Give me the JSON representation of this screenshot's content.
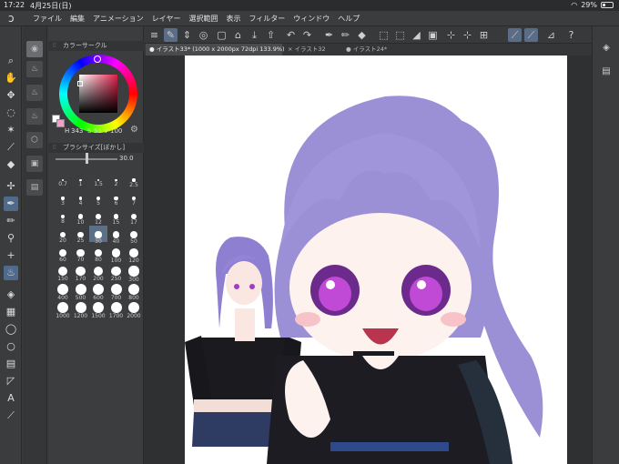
{
  "status": {
    "time": "17:22",
    "date": "4月25日(日)",
    "battery": "29%"
  },
  "menu": {
    "items": [
      "ファイル",
      "編集",
      "アニメーション",
      "レイヤー",
      "選択範囲",
      "表示",
      "フィルター",
      "ウィンドウ",
      "ヘルプ"
    ]
  },
  "color_panel": {
    "title": "カラーサークル",
    "h": "343",
    "s": "51",
    "v": "100",
    "h_mark": "H",
    "s_mark": "S",
    "v_mark": "V"
  },
  "brush_panel": {
    "title": "ブラシサイズ[ぼかし]",
    "value": "30.0",
    "sizes": [
      "0.7",
      "1",
      "1.5",
      "2",
      "2.5",
      "3",
      "4",
      "5",
      "6",
      "7",
      "8",
      "10",
      "12",
      "15",
      "17",
      "20",
      "25",
      "30",
      "40",
      "50",
      "60",
      "70",
      "80",
      "100",
      "120",
      "150",
      "170",
      "200",
      "250",
      "300",
      "400",
      "500",
      "600",
      "700",
      "800",
      "1000",
      "1200",
      "1500",
      "1700",
      "2000"
    ],
    "selected": "30"
  },
  "tabs": [
    {
      "label": "● イラスト33* (1000 x 2000px 72dpi 133.9%)",
      "active": true
    },
    {
      "label": "× イラスト32",
      "active": false
    },
    {
      "label": "● イラスト24*",
      "active": false
    }
  ],
  "icons": {
    "status_right": [
      "wifi-icon",
      "battery-icon"
    ],
    "tools": [
      "zoom-icon",
      "hand-icon",
      "move-layer-icon",
      "lasso-icon",
      "magic-wand-icon",
      "eyedropper-icon",
      "eraser-icon",
      "transform-icon",
      "pen-icon",
      "pencil-icon",
      "brush-icon",
      "airbrush-icon",
      "decoration-icon",
      "blend-icon",
      "fill-icon",
      "gradient-icon",
      "speech-bubble-icon",
      "circle-icon",
      "ruler-icon",
      "vector-icon",
      "text-icon",
      "correct-line-icon"
    ]
  },
  "colors": {
    "accent": "#5a6c86",
    "hair": "#9b8fd6",
    "background": "#3a3b3d"
  }
}
